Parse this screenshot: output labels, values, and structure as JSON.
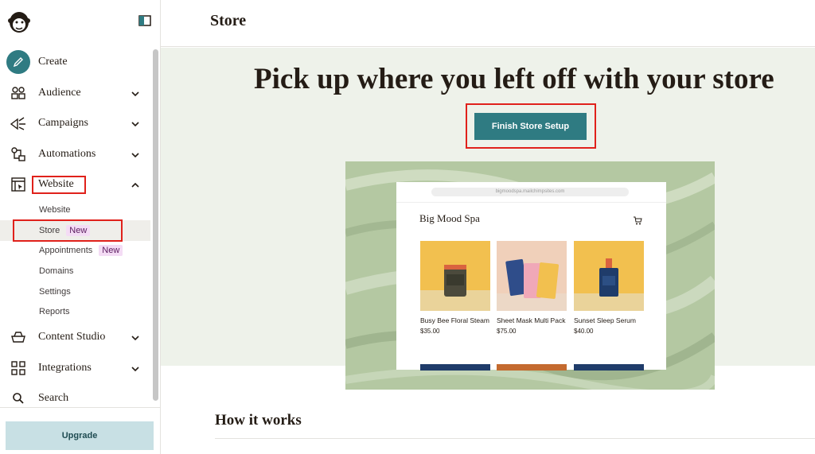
{
  "sidebar": {
    "nav": [
      {
        "key": "create",
        "label": "Create",
        "icon": "pencil-icon"
      },
      {
        "key": "audience",
        "label": "Audience",
        "icon": "audience-icon"
      },
      {
        "key": "campaigns",
        "label": "Campaigns",
        "icon": "megaphone-icon"
      },
      {
        "key": "automations",
        "label": "Automations",
        "icon": "automations-icon"
      },
      {
        "key": "website",
        "label": "Website",
        "icon": "website-icon"
      },
      {
        "key": "content_studio",
        "label": "Content Studio",
        "icon": "content-studio-icon"
      },
      {
        "key": "integrations",
        "label": "Integrations",
        "icon": "integrations-icon"
      },
      {
        "key": "search",
        "label": "Search",
        "icon": "search-icon"
      }
    ],
    "website_sub": [
      {
        "label": "Website"
      },
      {
        "label": "Store",
        "badge": "New"
      },
      {
        "label": "Appointments",
        "badge": "New"
      },
      {
        "label": "Domains"
      },
      {
        "label": "Settings"
      },
      {
        "label": "Reports"
      }
    ],
    "upgrade_label": "Upgrade"
  },
  "header": {
    "title": "Store"
  },
  "hero": {
    "title": "Pick up where you left off with your store",
    "cta_label": "Finish Store Setup"
  },
  "preview": {
    "url": "bigmoodspa.mailchimpsites.com",
    "shop_name": "Big Mood Spa",
    "products": [
      {
        "name": "Busy Bee Floral Steam",
        "price": "$35.00"
      },
      {
        "name": "Sheet Mask Multi Pack",
        "price": "$75.00"
      },
      {
        "name": "Sunset Sleep Serum",
        "price": "$40.00"
      }
    ]
  },
  "how": {
    "title": "How it works"
  },
  "colors": {
    "accent": "#2f7b82",
    "highlight": "#e0211b",
    "hero_bg": "#eef2ea",
    "upgrade_bg": "#c8e0e4"
  }
}
